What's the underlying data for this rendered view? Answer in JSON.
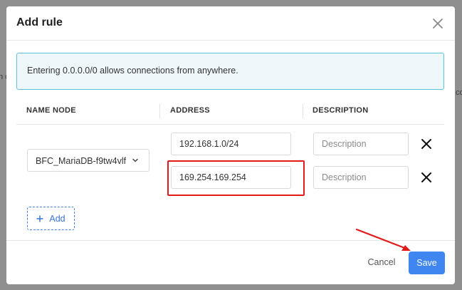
{
  "dialog": {
    "title": "Add rule",
    "alert": "Entering 0.0.0.0/0 allows connections from anywhere."
  },
  "table": {
    "headers": {
      "name_node": "NAME NODE",
      "address": "ADDRESS",
      "description": "DESCRIPTION"
    },
    "node_select": "BFC_MariaDB-f9tw4vlf",
    "rows": [
      {
        "address": "192.168.1.0/24",
        "description_placeholder": "Description"
      },
      {
        "address": "169.254.169.254",
        "description_placeholder": "Description"
      }
    ]
  },
  "add_label": "Add",
  "footer": {
    "cancel": "Cancel",
    "save": "Save"
  },
  "background": {
    "left_fragment": "n c",
    "right_fragment": "co"
  },
  "colors": {
    "primary": "#3f86f0",
    "alert_border": "#5cc3d6",
    "highlight": "#e01b1b"
  },
  "icons": [
    "close-icon",
    "chevron-down-icon",
    "plus-icon",
    "remove-icon"
  ]
}
